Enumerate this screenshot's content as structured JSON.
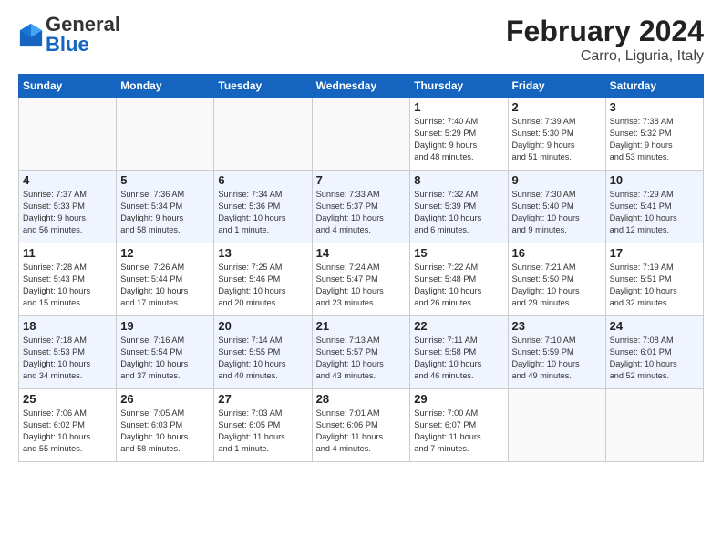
{
  "header": {
    "logo_general": "General",
    "logo_blue": "Blue",
    "title": "February 2024",
    "subtitle": "Carro, Liguria, Italy"
  },
  "weekdays": [
    "Sunday",
    "Monday",
    "Tuesday",
    "Wednesday",
    "Thursday",
    "Friday",
    "Saturday"
  ],
  "weeks": [
    [
      {
        "day": "",
        "info": ""
      },
      {
        "day": "",
        "info": ""
      },
      {
        "day": "",
        "info": ""
      },
      {
        "day": "",
        "info": ""
      },
      {
        "day": "1",
        "info": "Sunrise: 7:40 AM\nSunset: 5:29 PM\nDaylight: 9 hours\nand 48 minutes."
      },
      {
        "day": "2",
        "info": "Sunrise: 7:39 AM\nSunset: 5:30 PM\nDaylight: 9 hours\nand 51 minutes."
      },
      {
        "day": "3",
        "info": "Sunrise: 7:38 AM\nSunset: 5:32 PM\nDaylight: 9 hours\nand 53 minutes."
      }
    ],
    [
      {
        "day": "4",
        "info": "Sunrise: 7:37 AM\nSunset: 5:33 PM\nDaylight: 9 hours\nand 56 minutes."
      },
      {
        "day": "5",
        "info": "Sunrise: 7:36 AM\nSunset: 5:34 PM\nDaylight: 9 hours\nand 58 minutes."
      },
      {
        "day": "6",
        "info": "Sunrise: 7:34 AM\nSunset: 5:36 PM\nDaylight: 10 hours\nand 1 minute."
      },
      {
        "day": "7",
        "info": "Sunrise: 7:33 AM\nSunset: 5:37 PM\nDaylight: 10 hours\nand 4 minutes."
      },
      {
        "day": "8",
        "info": "Sunrise: 7:32 AM\nSunset: 5:39 PM\nDaylight: 10 hours\nand 6 minutes."
      },
      {
        "day": "9",
        "info": "Sunrise: 7:30 AM\nSunset: 5:40 PM\nDaylight: 10 hours\nand 9 minutes."
      },
      {
        "day": "10",
        "info": "Sunrise: 7:29 AM\nSunset: 5:41 PM\nDaylight: 10 hours\nand 12 minutes."
      }
    ],
    [
      {
        "day": "11",
        "info": "Sunrise: 7:28 AM\nSunset: 5:43 PM\nDaylight: 10 hours\nand 15 minutes."
      },
      {
        "day": "12",
        "info": "Sunrise: 7:26 AM\nSunset: 5:44 PM\nDaylight: 10 hours\nand 17 minutes."
      },
      {
        "day": "13",
        "info": "Sunrise: 7:25 AM\nSunset: 5:46 PM\nDaylight: 10 hours\nand 20 minutes."
      },
      {
        "day": "14",
        "info": "Sunrise: 7:24 AM\nSunset: 5:47 PM\nDaylight: 10 hours\nand 23 minutes."
      },
      {
        "day": "15",
        "info": "Sunrise: 7:22 AM\nSunset: 5:48 PM\nDaylight: 10 hours\nand 26 minutes."
      },
      {
        "day": "16",
        "info": "Sunrise: 7:21 AM\nSunset: 5:50 PM\nDaylight: 10 hours\nand 29 minutes."
      },
      {
        "day": "17",
        "info": "Sunrise: 7:19 AM\nSunset: 5:51 PM\nDaylight: 10 hours\nand 32 minutes."
      }
    ],
    [
      {
        "day": "18",
        "info": "Sunrise: 7:18 AM\nSunset: 5:53 PM\nDaylight: 10 hours\nand 34 minutes."
      },
      {
        "day": "19",
        "info": "Sunrise: 7:16 AM\nSunset: 5:54 PM\nDaylight: 10 hours\nand 37 minutes."
      },
      {
        "day": "20",
        "info": "Sunrise: 7:14 AM\nSunset: 5:55 PM\nDaylight: 10 hours\nand 40 minutes."
      },
      {
        "day": "21",
        "info": "Sunrise: 7:13 AM\nSunset: 5:57 PM\nDaylight: 10 hours\nand 43 minutes."
      },
      {
        "day": "22",
        "info": "Sunrise: 7:11 AM\nSunset: 5:58 PM\nDaylight: 10 hours\nand 46 minutes."
      },
      {
        "day": "23",
        "info": "Sunrise: 7:10 AM\nSunset: 5:59 PM\nDaylight: 10 hours\nand 49 minutes."
      },
      {
        "day": "24",
        "info": "Sunrise: 7:08 AM\nSunset: 6:01 PM\nDaylight: 10 hours\nand 52 minutes."
      }
    ],
    [
      {
        "day": "25",
        "info": "Sunrise: 7:06 AM\nSunset: 6:02 PM\nDaylight: 10 hours\nand 55 minutes."
      },
      {
        "day": "26",
        "info": "Sunrise: 7:05 AM\nSunset: 6:03 PM\nDaylight: 10 hours\nand 58 minutes."
      },
      {
        "day": "27",
        "info": "Sunrise: 7:03 AM\nSunset: 6:05 PM\nDaylight: 11 hours\nand 1 minute."
      },
      {
        "day": "28",
        "info": "Sunrise: 7:01 AM\nSunset: 6:06 PM\nDaylight: 11 hours\nand 4 minutes."
      },
      {
        "day": "29",
        "info": "Sunrise: 7:00 AM\nSunset: 6:07 PM\nDaylight: 11 hours\nand 7 minutes."
      },
      {
        "day": "",
        "info": ""
      },
      {
        "day": "",
        "info": ""
      }
    ]
  ]
}
